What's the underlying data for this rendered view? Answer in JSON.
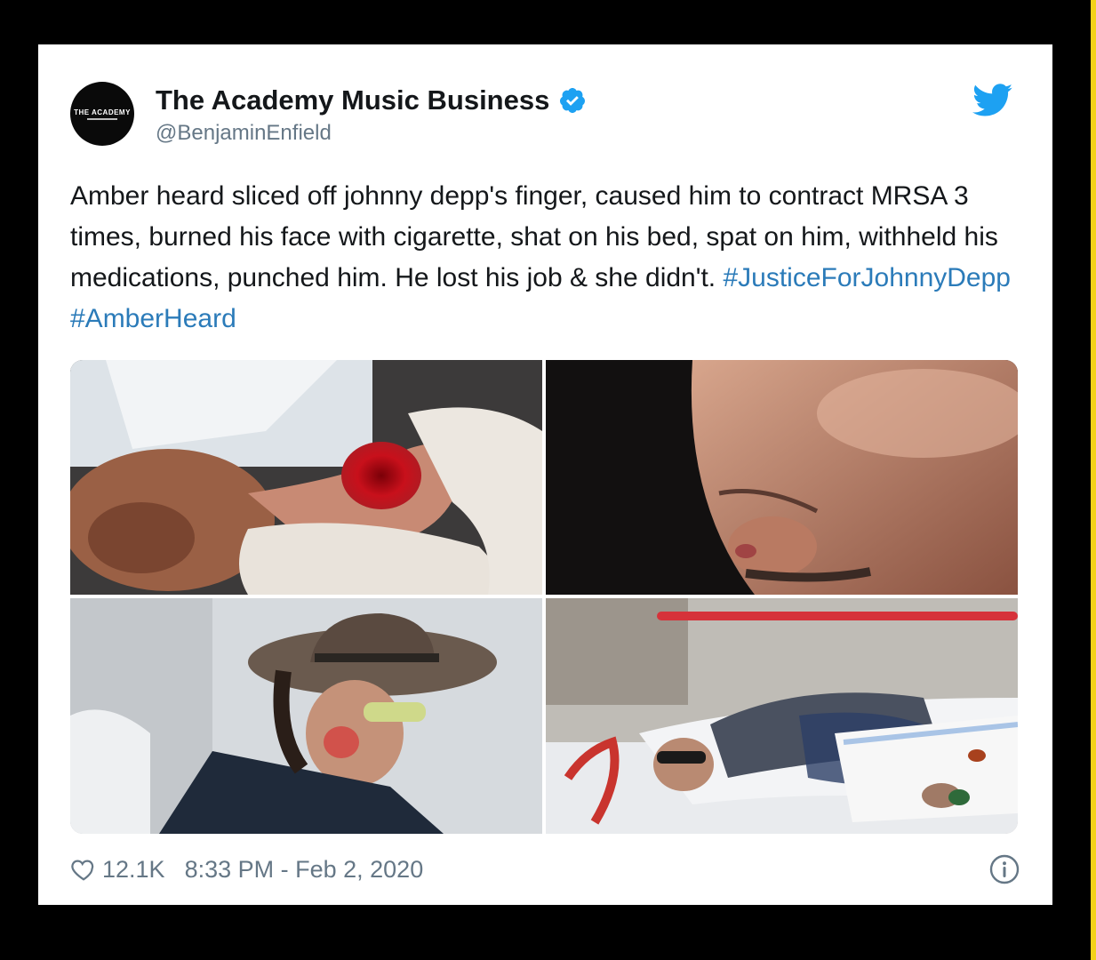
{
  "tweet": {
    "author": {
      "display_name": "The Academy Music Business",
      "handle": "@BenjaminEnfield",
      "avatar_logo_text": "THE ACADEMY",
      "verified": true
    },
    "text": {
      "body": "Amber heard sliced off johnny depp's finger, caused him to contract MRSA 3 times, burned his face with cigarette, shat on his bed, spat on him, withheld his medications, punched him. He lost his job & she didn't.",
      "hashtags": [
        "#JusticeForJohnnyDepp",
        "#AmberHeard"
      ]
    },
    "media": {
      "photos": [
        {
          "name": "injured-finger-photo"
        },
        {
          "name": "face-bruise-photo"
        },
        {
          "name": "hat-cheek-mark-photo"
        },
        {
          "name": "hospital-bed-photo"
        }
      ]
    },
    "footer": {
      "likes": "12.1K",
      "timestamp": "8:33 PM - Feb 2, 2020"
    }
  },
  "icons": {
    "verified": "verified-badge-icon",
    "twitter": "twitter-bird-icon",
    "like": "heart-icon",
    "info": "info-icon"
  },
  "colors": {
    "accent": "#1da1f2",
    "hashtag": "#2b7bb9",
    "text": "#14171a",
    "muted": "#657786",
    "background": "#000000",
    "card": "#ffffff",
    "stripe": "#f4d21a"
  }
}
